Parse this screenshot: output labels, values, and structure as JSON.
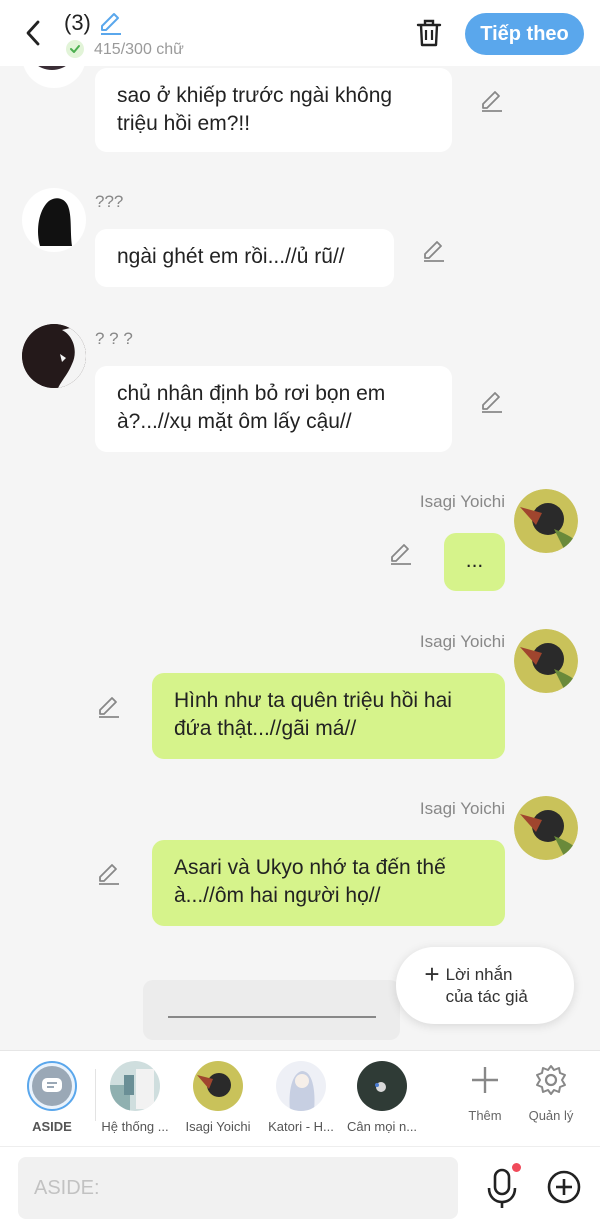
{
  "header": {
    "chapter_count": "(3)",
    "word_count": "415/300 chữ",
    "next_label": "Tiếp theo"
  },
  "messages": [
    {
      "id": "m1",
      "side": "left",
      "name": "",
      "lines": [
        "sao ở khiếp trước ngài không",
        "triệu hồi em?!!"
      ]
    },
    {
      "id": "m2",
      "side": "left",
      "name": "???",
      "lines": [
        "ngài ghét em rồi...//ủ rũ//"
      ]
    },
    {
      "id": "m3",
      "side": "left",
      "name": "? ? ?",
      "lines": [
        "chủ nhân định bỏ rơi bọn em",
        "à?...//xụ mặt ôm lấy cậu//"
      ]
    },
    {
      "id": "m4",
      "side": "right",
      "name": "Isagi Yoichi",
      "lines": [
        "..."
      ]
    },
    {
      "id": "m5",
      "side": "right",
      "name": "Isagi Yoichi",
      "lines": [
        "Hình như ta quên triệu hồi hai",
        "đứa thật...//gãi má//"
      ]
    },
    {
      "id": "m6",
      "side": "right",
      "name": "Isagi Yoichi",
      "lines": [
        "Asari và Ukyo nhớ ta đến thế",
        "à...//ôm hai người họ//"
      ]
    }
  ],
  "author_note": {
    "label_line1": "Lời nhắn",
    "label_line2": "của tác giả"
  },
  "characters": [
    {
      "name": "ASIDE",
      "active": true
    },
    {
      "name": "Hệ thống ...",
      "active": false
    },
    {
      "name": "Isagi Yoichi",
      "active": false
    },
    {
      "name": "Katori - H...",
      "active": false
    },
    {
      "name": "Cân mọi n...",
      "active": false
    }
  ],
  "tools": {
    "add_label": "Thêm",
    "manage_label": "Quản lý"
  },
  "input": {
    "placeholder": "ASIDE:"
  },
  "colors": {
    "accent": "#5aa7ec",
    "right_bubble": "#d6f38b",
    "left_bubble": "#ffffff"
  }
}
